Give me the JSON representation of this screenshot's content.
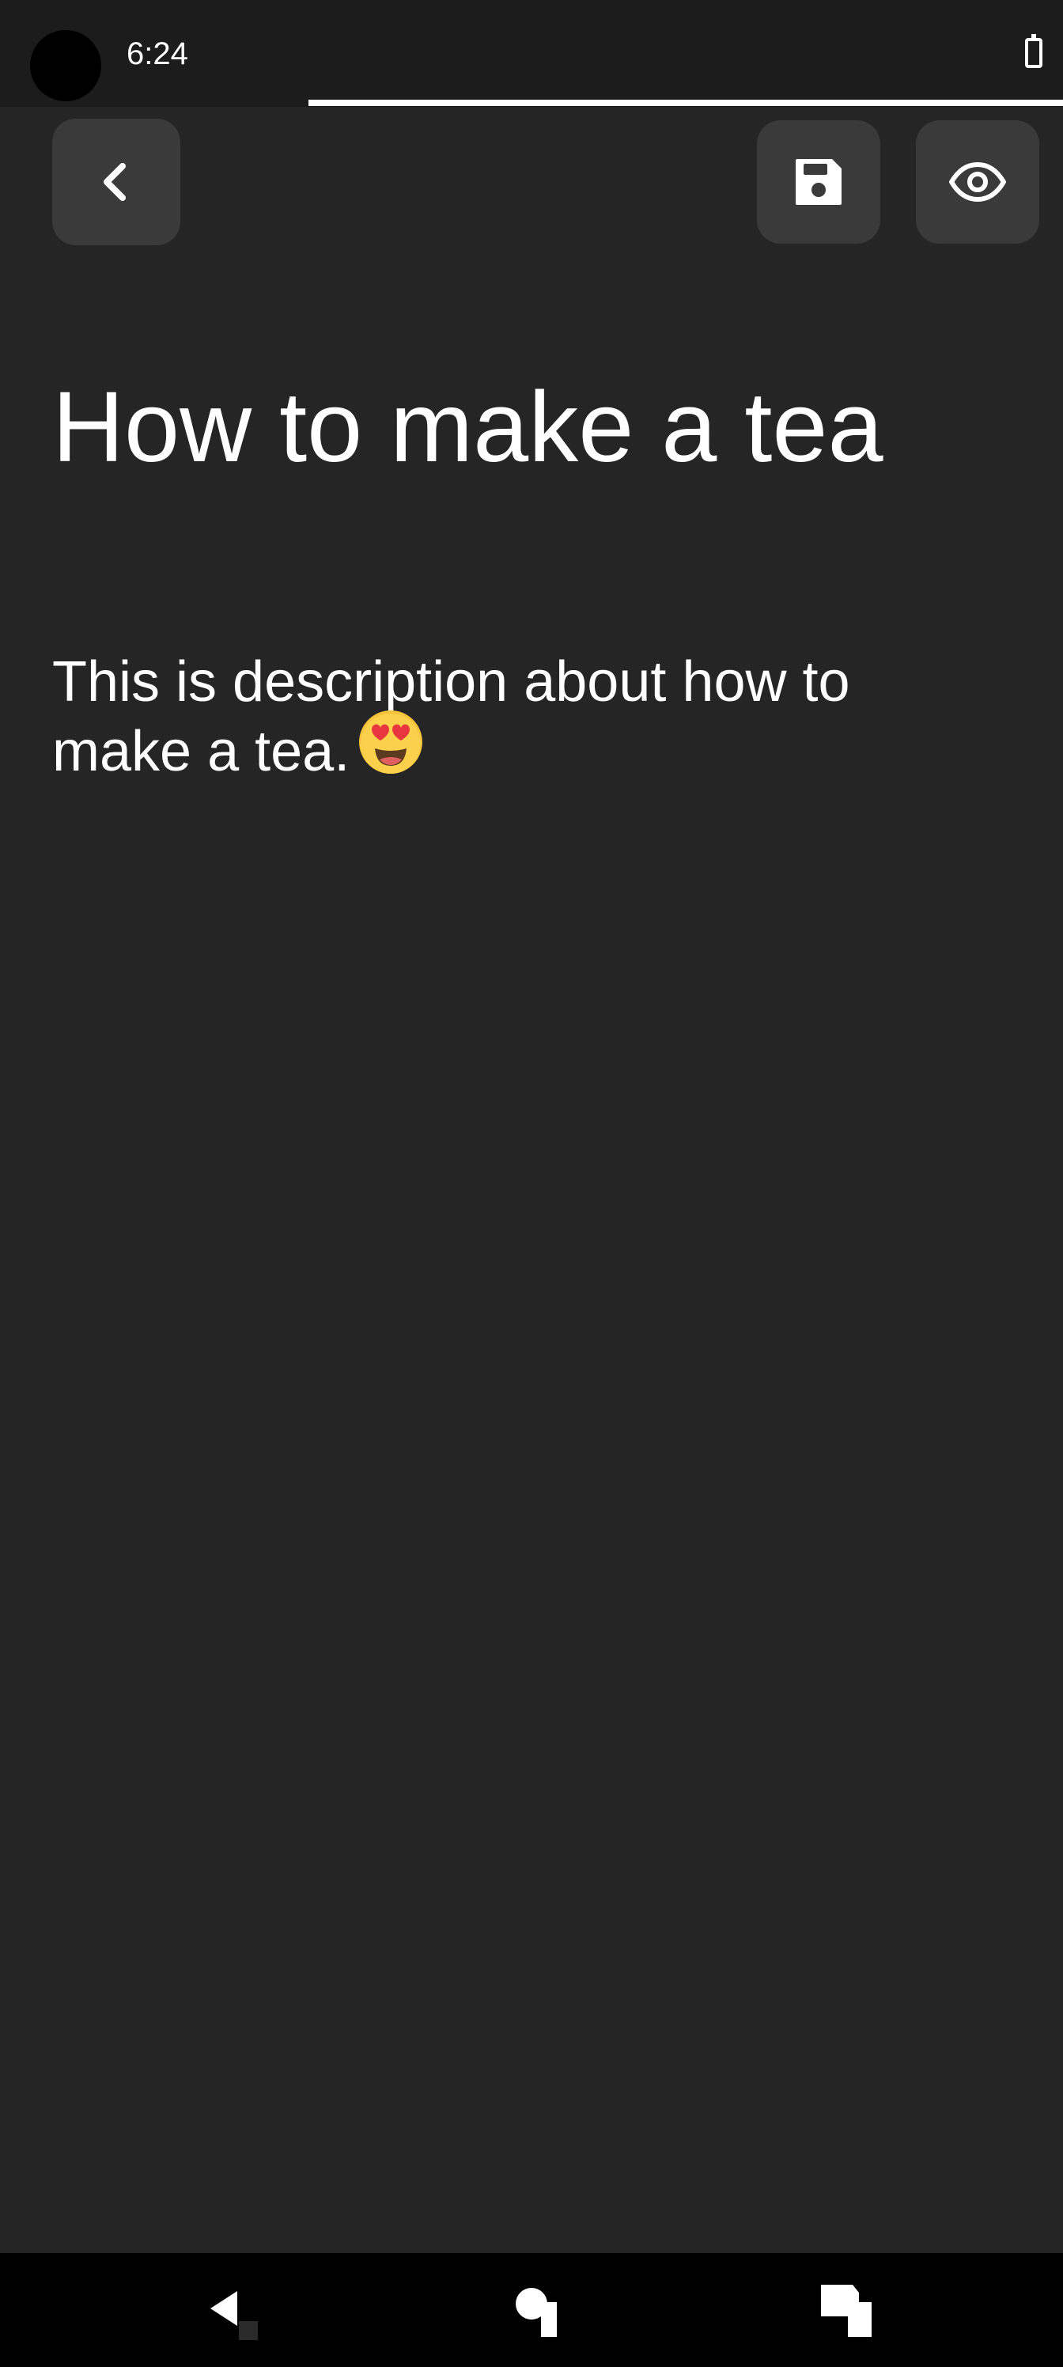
{
  "status_bar": {
    "time": "6:24",
    "battery_icon": "battery-icon",
    "page_progress": 0.71
  },
  "toolbar": {
    "back_icon": "chevron-left-icon",
    "save_icon": "floppy-disk-icon",
    "preview_icon": "eye-icon",
    "button_color": "#3a3a3a"
  },
  "note": {
    "title": "How to make a tea",
    "description": "This is description about how to make a tea.",
    "emoji": "smiling-face-with-heart-eyes"
  },
  "nav_bar": {
    "back_icon": "back-triangle-icon",
    "home_icon": "home-icon",
    "recents_icon": "recents-icon"
  },
  "colors": {
    "background": "#252525",
    "status_bar": "#1c1c1c",
    "text": "#ffffff",
    "nav_bar": "#000000"
  }
}
